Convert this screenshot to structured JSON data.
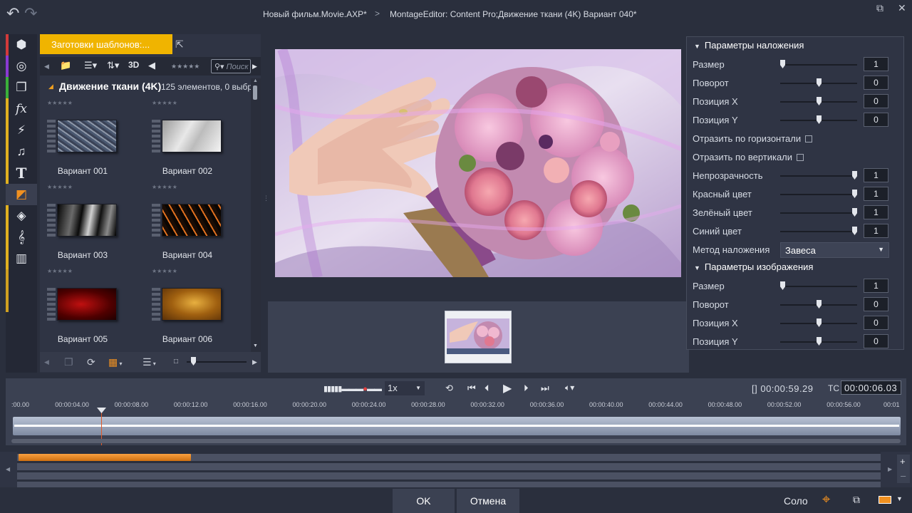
{
  "window": {
    "project_file": "Новый фильм.Movie.AXP",
    "editor_path": "MontageEditor: Content Pro;Движение ткани (4K)  Вариант 040",
    "modified_mark": "*",
    "separator": ">"
  },
  "rail": {
    "items": [
      {
        "icon": "package-icon",
        "glyph": "⬢"
      },
      {
        "icon": "film-reel-icon",
        "glyph": "◎"
      },
      {
        "icon": "stack-icon",
        "glyph": "❐"
      },
      {
        "icon": "effects-icon",
        "glyph": "fx"
      },
      {
        "icon": "lightning-icon",
        "glyph": "⚡"
      },
      {
        "icon": "music-icon",
        "glyph": "♫"
      },
      {
        "icon": "text-icon",
        "glyph": "T"
      },
      {
        "icon": "montage-icon",
        "glyph": "◩"
      },
      {
        "icon": "layers-icon",
        "glyph": "◈"
      },
      {
        "icon": "audio-clef-icon",
        "glyph": "𝄞"
      },
      {
        "icon": "piano-icon",
        "glyph": "▥"
      }
    ]
  },
  "library": {
    "tab_label": "Заготовки шаблонов:...",
    "search_placeholder": "Поиск",
    "view_3d_label": "3D",
    "group_name": "Движение ткани (4K)",
    "group_count": "125 элементов, 0 выбр",
    "tiles": [
      {
        "label": "Вариант 001",
        "rating": "★★★★★"
      },
      {
        "label": "Вариант 002",
        "rating": "★★★★★"
      },
      {
        "label": "Вариант 003",
        "rating": "★★★★★"
      },
      {
        "label": "Вариант 004",
        "rating": "★★★★★"
      },
      {
        "label": "Вариант 005",
        "rating": "★★★★★"
      },
      {
        "label": "Вариант 006",
        "rating": "★★★★★"
      }
    ],
    "top_rating": "★★★★★",
    "toolbar_rating": "★★★★★"
  },
  "overlay_params": {
    "title": "Параметры наложения",
    "rows": [
      {
        "label": "Размер",
        "value": "1",
        "level": 0.0
      },
      {
        "label": "Поворот",
        "value": "0",
        "level": 0.5
      },
      {
        "label": "Позиция X",
        "value": "0",
        "level": 0.5
      },
      {
        "label": "Позиция Y",
        "value": "0",
        "level": 0.5
      }
    ],
    "flip_h_label": "Отразить по горизонтали",
    "flip_v_label": "Отразить по вертикали",
    "color_rows": [
      {
        "label": "Непрозрачность",
        "value": "1",
        "level": 1.0
      },
      {
        "label": "Красный цвет",
        "value": "1",
        "level": 1.0
      },
      {
        "label": "Зелёный цвет",
        "value": "1",
        "level": 1.0
      },
      {
        "label": "Синий цвет",
        "value": "1",
        "level": 1.0
      }
    ],
    "blend_label": "Метод наложения",
    "blend_value": "Завеса"
  },
  "image_params": {
    "title": "Параметры изображения",
    "rows": [
      {
        "label": "Размер",
        "value": "1",
        "level": 0.0
      },
      {
        "label": "Поворот",
        "value": "0",
        "level": 0.5
      },
      {
        "label": "Позиция X",
        "value": "0",
        "level": 0.5
      },
      {
        "label": "Позиция Y",
        "value": "0",
        "level": 0.5
      }
    ]
  },
  "transport": {
    "speed": "1x",
    "duration": "[] 00:00:59.29",
    "tc_label": "TC",
    "current_tc": "00:00:06.03"
  },
  "ruler_ticks": [
    ":00.00",
    "00:00:04.00",
    "00:00:08.00",
    "00:00:12.00",
    "00:00:16.00",
    "00:00:20.00",
    "00:00:24.00",
    "00:00:28.00",
    "00:00:32.00",
    "00:00:36.00",
    "00:00:40.00",
    "00:00:44.00",
    "00:00:48.00",
    "00:00:52.00",
    "00:00:56.00",
    "00:01"
  ],
  "footer": {
    "ok_label": "OK",
    "cancel_label": "Отмена",
    "solo_label": "Соло"
  },
  "colors": {
    "accent_yellow": "#f0b400",
    "accent_orange": "#f09020",
    "playhead": "#e05a2a"
  }
}
